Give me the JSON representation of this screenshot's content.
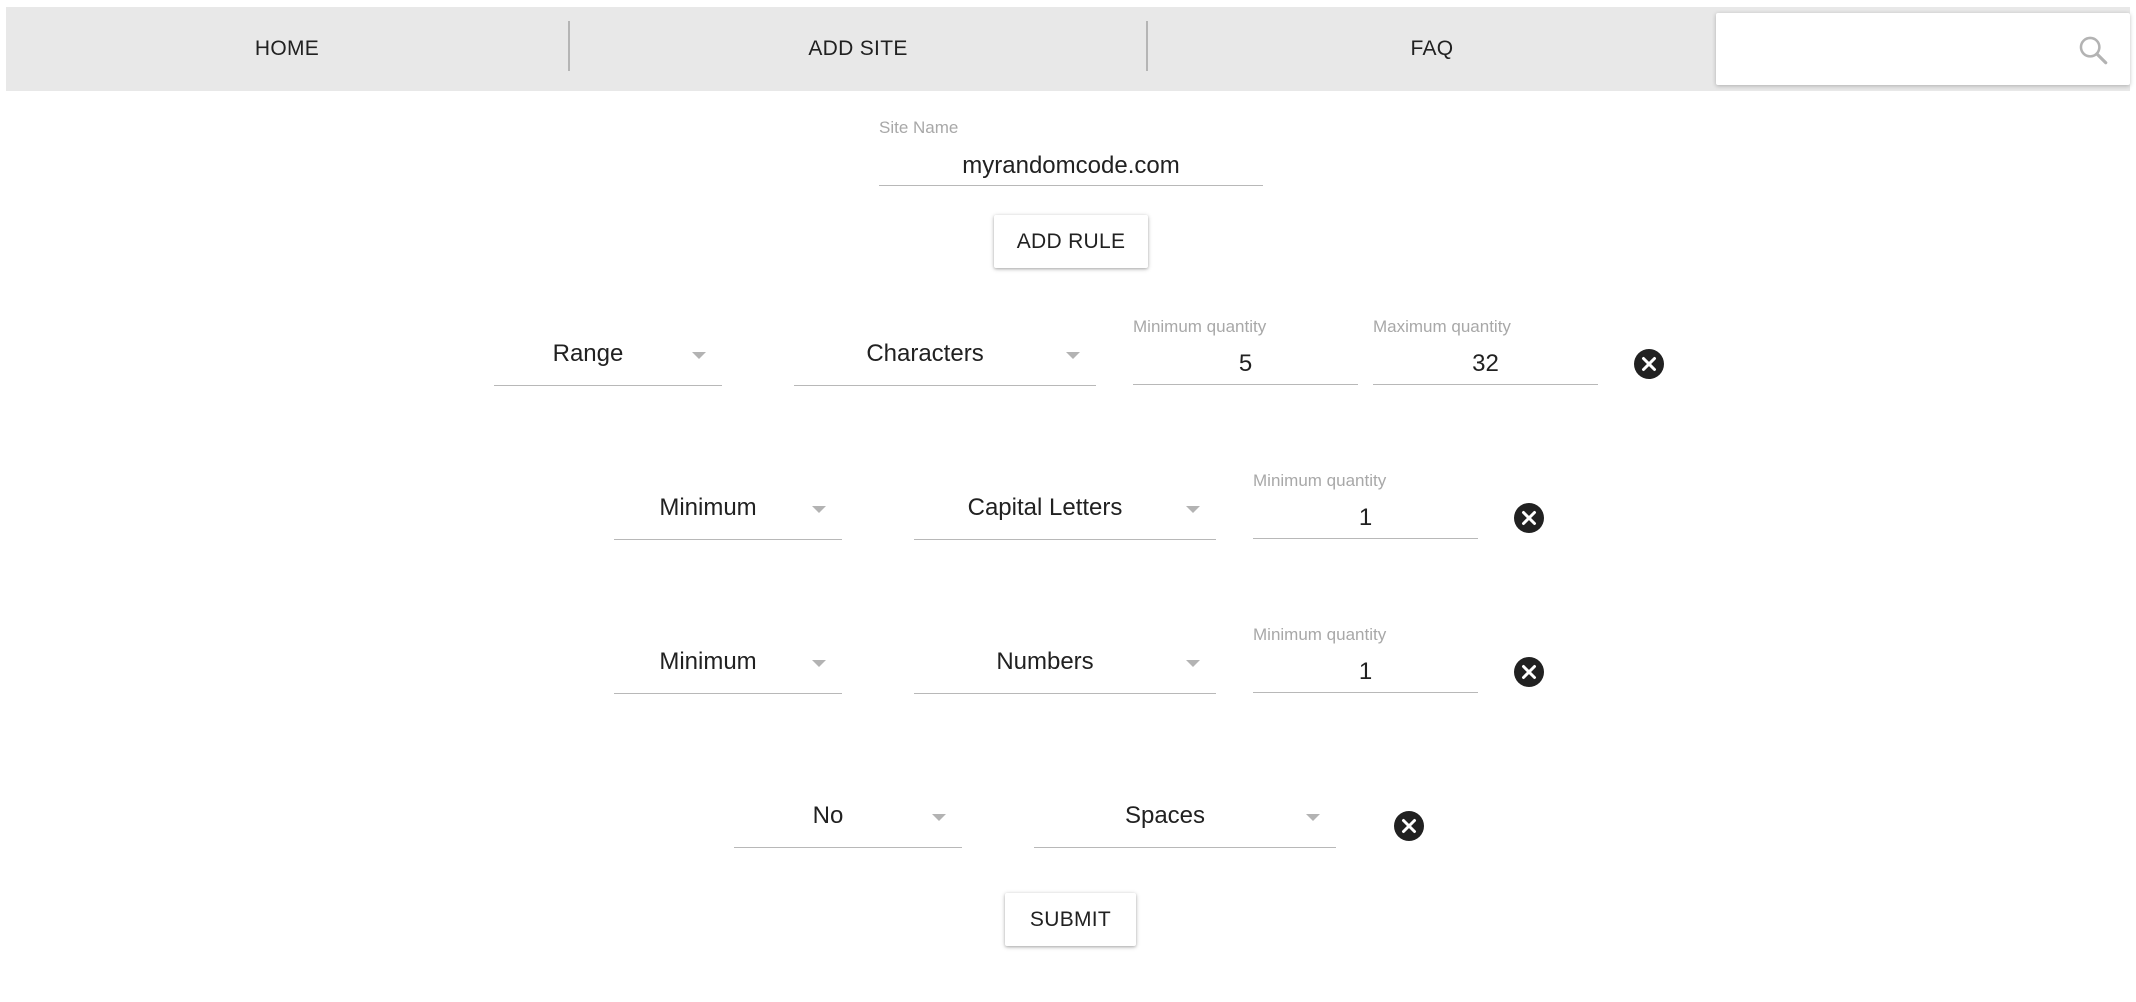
{
  "nav": {
    "items": [
      {
        "label": "HOME"
      },
      {
        "label": "ADD SITE"
      },
      {
        "label": "FAQ"
      }
    ],
    "search": {
      "value": "",
      "placeholder": ""
    }
  },
  "form": {
    "site_name_label": "Site Name",
    "site_name_value": "myrandomcode.com",
    "add_rule_label": "ADD RULE",
    "submit_label": "SUBMIT"
  },
  "rules": [
    {
      "type": "Range",
      "target": "Characters",
      "min_label": "Minimum quantity",
      "min_value": "5",
      "max_label": "Maximum quantity",
      "max_value": "32"
    },
    {
      "type": "Minimum",
      "target": "Capital Letters",
      "min_label": "Minimum quantity",
      "min_value": "1"
    },
    {
      "type": "Minimum",
      "target": "Numbers",
      "min_label": "Minimum quantity",
      "min_value": "1"
    },
    {
      "type": "No",
      "target": "Spaces"
    }
  ],
  "colors": {
    "navbar_bg": "#e8e8e8",
    "label_gray": "#a8a8a8",
    "text_dark": "#212121",
    "remove_icon": "#212121"
  },
  "icons": {
    "search": "search-icon",
    "remove": "close-circle-icon",
    "dropdown": "caret-down-icon"
  }
}
